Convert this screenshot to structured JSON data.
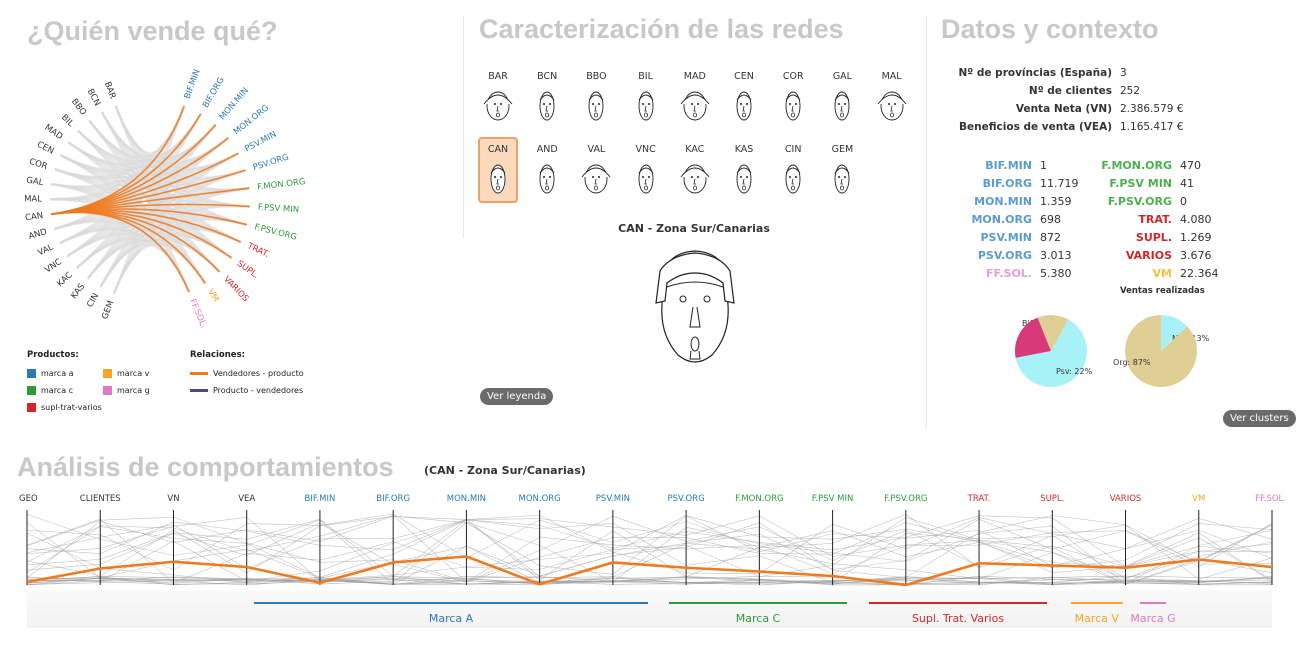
{
  "sections": {
    "who_sells": "¿Quién vende qué?",
    "networks": "Caracterización de las redes",
    "context": "Datos y contexto",
    "behaviour": "Análisis de comportamientos",
    "behaviour_subtitle": "(CAN - Zona Sur/Canarias)"
  },
  "colors": {
    "brand_a": "#2a7ab5",
    "brand_c": "#2f9a3a",
    "supl": "#d62728",
    "brand_v": "#f5a623",
    "brand_g": "#e377c2",
    "highlight": "#f07a1f",
    "title_gray": "#c8c8c8"
  },
  "chord": {
    "vendors": [
      "BAR",
      "BCN",
      "BBO",
      "BIL",
      "MAD",
      "CEN",
      "COR",
      "GAL",
      "MAL",
      "CAN",
      "AND",
      "VAL",
      "VNC",
      "KAC",
      "KAS",
      "CIN",
      "GEM"
    ],
    "products": [
      {
        "label": "BIF.MIN",
        "group": "a"
      },
      {
        "label": "BIF.ORG",
        "group": "a"
      },
      {
        "label": "MON.MIN",
        "group": "a"
      },
      {
        "label": "MON.ORG",
        "group": "a"
      },
      {
        "label": "PSV.MIN",
        "group": "a"
      },
      {
        "label": "PSV.ORG",
        "group": "a"
      },
      {
        "label": "F.MON.ORG",
        "group": "c"
      },
      {
        "label": "F.PSV MIN",
        "group": "c"
      },
      {
        "label": "F.PSV.ORG",
        "group": "c"
      },
      {
        "label": "TRAT.",
        "group": "s"
      },
      {
        "label": "SUPL.",
        "group": "s"
      },
      {
        "label": "VARIOS",
        "group": "s"
      },
      {
        "label": "VM",
        "group": "v"
      },
      {
        "label": "FF.SOL.",
        "group": "g"
      }
    ],
    "selected_vendor": "CAN"
  },
  "legend": {
    "products_title": "Productos:",
    "products": [
      {
        "label": "marca a",
        "color": "#2a7ab5"
      },
      {
        "label": "marca v",
        "color": "#f5a623"
      },
      {
        "label": "marca c",
        "color": "#2f9a3a"
      },
      {
        "label": "marca g",
        "color": "#e377c2"
      },
      {
        "label": "supl-trat-varios",
        "color": "#d62728"
      }
    ],
    "relations_title": "Relaciones:",
    "relations": [
      {
        "label": "Vendedores - producto",
        "color": "#f07a1f"
      },
      {
        "label": "Producto - vendedores",
        "color": "#4a4a7a"
      }
    ]
  },
  "faces": {
    "row1": [
      "BAR",
      "BCN",
      "BBO",
      "BIL",
      "MAD",
      "CEN",
      "COR",
      "GAL",
      "MAL"
    ],
    "row2": [
      "CAN",
      "AND",
      "VAL",
      "VNC",
      "KAC",
      "KAS",
      "CIN",
      "GEM"
    ],
    "selected": "CAN",
    "caption": "CAN - Zona Sur/Canarias",
    "legend_button": "Ver leyenda"
  },
  "context": {
    "rows": [
      {
        "k": "Nº de províncias (España)",
        "v": "3"
      },
      {
        "k": "Nº de clientes",
        "v": "252"
      },
      {
        "k": "Venta Neta (VN)",
        "v": "2.386.579 €"
      },
      {
        "k": "Beneficios de venta (VEA)",
        "v": "1.165.417 €"
      }
    ],
    "products_left": [
      {
        "k": "BIF.MIN",
        "v": "1",
        "color": "#5b9bd0"
      },
      {
        "k": "BIF.ORG",
        "v": "11.719",
        "color": "#5b9bd0"
      },
      {
        "k": "MON.MIN",
        "v": "1.359",
        "color": "#5b9bd0"
      },
      {
        "k": "MON.ORG",
        "v": "698",
        "color": "#5b9bd0"
      },
      {
        "k": "PSV.MIN",
        "v": "872",
        "color": "#5b9bd0"
      },
      {
        "k": "PSV.ORG",
        "v": "3.013",
        "color": "#5b9bd0"
      },
      {
        "k": "FF.SOL.",
        "v": "5.380",
        "color": "#e69ee0"
      }
    ],
    "products_right": [
      {
        "k": "F.MON.ORG",
        "v": "470",
        "color": "#4caf50"
      },
      {
        "k": "F.PSV MIN",
        "v": "41",
        "color": "#4caf50"
      },
      {
        "k": "F.PSV.ORG",
        "v": "0",
        "color": "#4caf50"
      },
      {
        "k": "TRAT.",
        "v": "4.080",
        "color": "#d62728"
      },
      {
        "k": "SUPL.",
        "v": "1.269",
        "color": "#d62728"
      },
      {
        "k": "VARIOS",
        "v": "3.676",
        "color": "#d62728"
      },
      {
        "k": "VM",
        "v": "22.364",
        "color": "#f5c040"
      }
    ],
    "sales_title": "Ventas realizadas",
    "clusters_button": "Ver clusters"
  },
  "chart_data": [
    {
      "type": "pie",
      "slices": [
        {
          "label": "Bif: 64%",
          "value": 64,
          "color": "#a8f2f7"
        },
        {
          "label": "Psv: 22%",
          "value": 22,
          "color": "#d63a78"
        },
        {
          "label": "",
          "value": 14,
          "color": "#e0cf94"
        }
      ]
    },
    {
      "type": "pie",
      "slices": [
        {
          "label": "Min: 13%",
          "value": 13,
          "color": "#a8f2f7"
        },
        {
          "label": "Org: 87%",
          "value": 87,
          "color": "#e0cf94"
        }
      ]
    },
    {
      "type": "line",
      "axes": [
        {
          "label": "GEO",
          "color": "#333"
        },
        {
          "label": "CLIENTES",
          "color": "#333"
        },
        {
          "label": "VN",
          "color": "#333"
        },
        {
          "label": "VEA",
          "color": "#333"
        },
        {
          "label": "BIF.MIN",
          "color": "#2a7ab5"
        },
        {
          "label": "BIF.ORG",
          "color": "#2a7ab5"
        },
        {
          "label": "MON.MIN",
          "color": "#2a7ab5"
        },
        {
          "label": "MON.ORG",
          "color": "#2a7ab5"
        },
        {
          "label": "PSV.MIN",
          "color": "#2a7ab5"
        },
        {
          "label": "PSV.ORG",
          "color": "#2a7ab5"
        },
        {
          "label": "F.MON.ORG",
          "color": "#2f9a3a"
        },
        {
          "label": "F.PSV MIN",
          "color": "#2f9a3a"
        },
        {
          "label": "F.PSV.ORG",
          "color": "#2f9a3a"
        },
        {
          "label": "TRAT.",
          "color": "#d62728"
        },
        {
          "label": "SUPL.",
          "color": "#d62728"
        },
        {
          "label": "VARIOS",
          "color": "#d62728"
        },
        {
          "label": "VM",
          "color": "#f5a623"
        },
        {
          "label": "FF.SOL.",
          "color": "#e377c2"
        }
      ],
      "highlight_series": {
        "name": "CAN",
        "values": [
          0.04,
          0.22,
          0.31,
          0.24,
          0.03,
          0.3,
          0.38,
          0.01,
          0.3,
          0.23,
          0.18,
          0.12,
          0.0,
          0.29,
          0.26,
          0.23,
          0.34,
          0.24
        ]
      },
      "brands": [
        {
          "label": "Marca A",
          "color": "#2a7ab5"
        },
        {
          "label": "Marca C",
          "color": "#2f9a3a"
        },
        {
          "label": "Supl. Trat. Varios",
          "color": "#d62728"
        },
        {
          "label": "Marca V",
          "color": "#f5a623"
        },
        {
          "label": "Marca G",
          "color": "#e377c2"
        }
      ]
    }
  ]
}
